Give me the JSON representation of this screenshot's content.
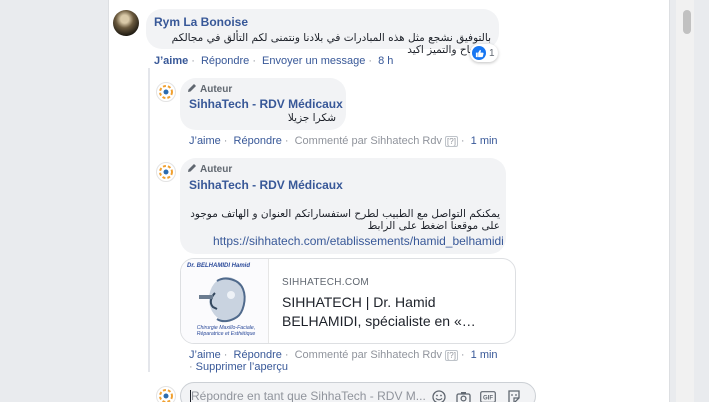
{
  "comment": {
    "author": "Rym La Bonoise",
    "text": "بالتوفيق نشجع مثل هذه المبادرات في بلادنا ونتمنى لكم التألق في مجالكم والنجاح والتميز اكيد",
    "reaction_count": "1",
    "actions": {
      "like": "J’aime",
      "reply": "Répondre",
      "send_message": "Envoyer un message",
      "time": "8 h"
    }
  },
  "reply1": {
    "author_tag": "Auteur",
    "author": "SihhaTech - RDV Médicaux",
    "text": "شكرا جزيلا",
    "actions": {
      "like": "J’aime",
      "reply": "Répondre",
      "commented_by": "Commenté par Sihhatech Rdv",
      "help": "[?]",
      "time": "1 min"
    }
  },
  "reply2": {
    "author_tag": "Auteur",
    "author": "SihhaTech - RDV Médicaux",
    "text": "يمكنكم التواصل مع الطبيب لطرح استفساراتكم العنوان و الهاتف موجود على موقعنا اضغط على الرابط",
    "link": "https://sihhatech.com/etablissements/hamid_belhamidi",
    "preview": {
      "image_title": "Dr. BELHAMIDI Hamid",
      "image_caption": "Chirurgie Maxillo-Faciale, Réparatrice et Esthétique",
      "domain": "SIHHATECH.COM",
      "title": "SIHHATECH | Dr. Hamid BELHAMIDI, spécialiste en «…"
    },
    "actions": {
      "like": "J’aime",
      "reply": "Répondre",
      "commented_by": "Commenté par Sihhatech Rdv",
      "help": "[?]",
      "time": "1 min",
      "remove_preview": "Supprimer l’aperçu"
    }
  },
  "reply_box": {
    "placeholder": "Répondre en tant que SihhaTech - RDV M..."
  },
  "icons": [
    "pencil-icon",
    "like-icon",
    "emoji-icon",
    "camera-icon",
    "gif-icon",
    "sticker-icon"
  ],
  "colors": {
    "link": "#385898",
    "like": "#1877f2",
    "bubble": "#f2f3f5"
  }
}
